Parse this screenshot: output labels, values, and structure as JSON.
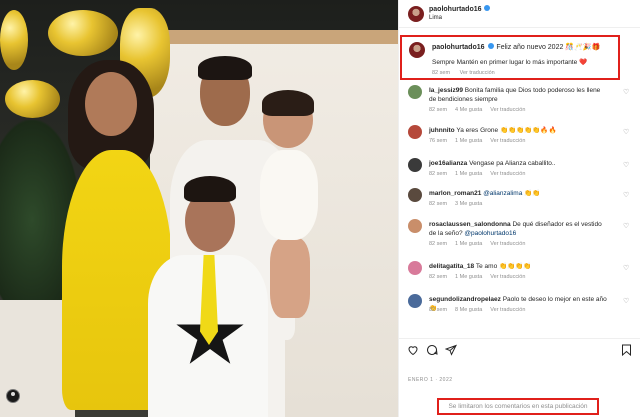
{
  "post": {
    "username": "paolohurtado16",
    "location": "Lima",
    "caption": {
      "username": "paolohurtado16",
      "text": "Feliz año nuevo 2022 🎊🥂🎉🎁",
      "body": "Sempre Mantén en primer lugar lo más importante ❤️",
      "time": "82 sem",
      "translate": "Ver traducción"
    },
    "comments": [
      {
        "username": "la_jessiz99",
        "text": "Bonita familia que Dios todo poderoso les llene de bendiciones siempre",
        "time": "82 sem",
        "likes": "4 Me gusta",
        "translate": "Ver traducción",
        "avatar_color": "#6b8f5a"
      },
      {
        "username": "juhnnito",
        "text": "Ya eres Grone 👏👏👏👏👏🔥🔥",
        "time": "76 sem",
        "likes": "1 Me gusta",
        "translate": "Ver traducción",
        "avatar_color": "#b5483a"
      },
      {
        "username": "joe16alianza",
        "text": "Vengase pa Alianza caballito..",
        "time": "82 sem",
        "likes": "1 Me gusta",
        "translate": "Ver traducción",
        "avatar_color": "#3a3a3a"
      },
      {
        "username": "marlon_roman21",
        "text": "@alianzalima 👏👏",
        "time": "82 sem",
        "likes": "3 Me gusta",
        "translate": "",
        "avatar_color": "#5a4a3e"
      },
      {
        "username": "rosaclaussen_salondonna",
        "text": "De qué diseñador es el vestido de la seño? @paolohurtado16",
        "time": "82 sem",
        "likes": "1 Me gusta",
        "translate": "Ver traducción",
        "avatar_color": "#c98e6a"
      },
      {
        "username": "delitagatita_18",
        "text": "Te amo 👏👏👏👏",
        "time": "82 sem",
        "likes": "1 Me gusta",
        "translate": "Ver traducción",
        "avatar_color": "#d87a9a"
      },
      {
        "username": "segundolizandropelaez",
        "text": "Paolo te deseo lo mejor en este año 👏",
        "time": "82 sem",
        "likes": "8 Me gusta",
        "translate": "Ver traducción",
        "avatar_color": "#4a6a9a"
      }
    ],
    "date": "ENERO 1 · 2022",
    "comments_disabled": "Se limitaron los comentarios en esta publicación"
  },
  "icons": {
    "like": "heart-icon",
    "comment": "comment-icon",
    "share": "share-icon",
    "save": "bookmark-icon"
  },
  "colors": {
    "highlight": "#e0201b",
    "verified": "#3897f0",
    "mention": "#00376b",
    "dress": "#f2d514"
  }
}
